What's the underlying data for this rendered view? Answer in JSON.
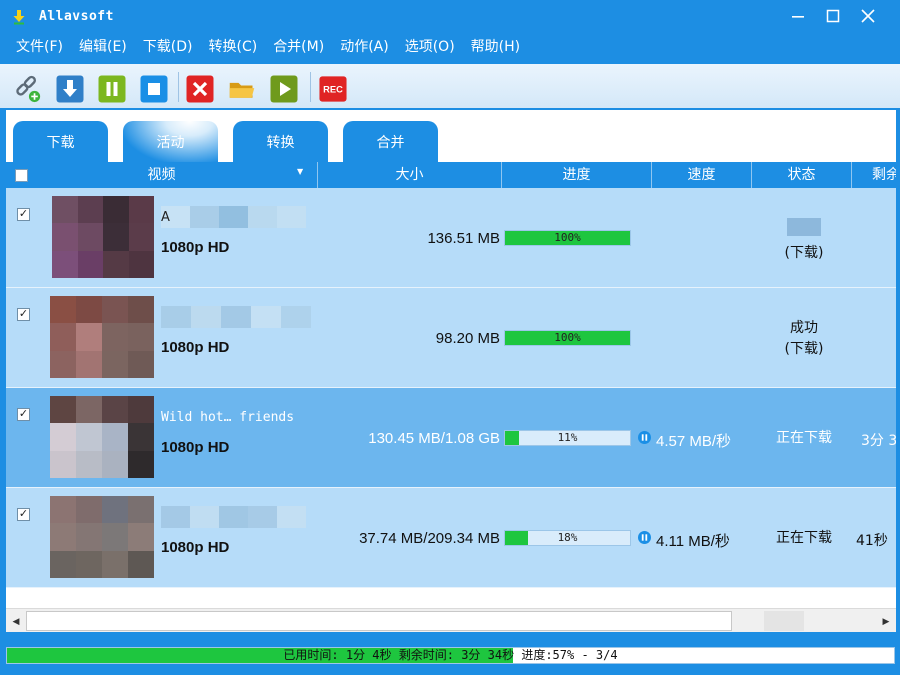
{
  "window": {
    "title": "Allavsoft",
    "icon": "download-arrow-icon",
    "controls": [
      "minimize-icon",
      "maximize-icon",
      "close-icon"
    ]
  },
  "menu": [
    "文件(F)",
    "编辑(E)",
    "下载(D)",
    "转换(C)",
    "合并(M)",
    "动作(A)",
    "选项(O)",
    "帮助(H)"
  ],
  "toolbar": {
    "buttons": [
      {
        "name": "paste-url",
        "icon": "link-add-icon"
      },
      {
        "name": "download",
        "icon": "download-icon"
      },
      {
        "name": "pause",
        "icon": "pause-icon"
      },
      {
        "name": "stop",
        "icon": "stop-icon"
      },
      {
        "name": "delete",
        "icon": "delete-icon"
      },
      {
        "name": "open-folder",
        "icon": "folder-icon"
      },
      {
        "name": "play",
        "icon": "play-icon"
      },
      {
        "name": "record",
        "icon": "rec-icon",
        "label": "REC"
      }
    ]
  },
  "tabs": [
    {
      "label": "下载",
      "active": false
    },
    {
      "label": "活动",
      "active": true
    },
    {
      "label": "转换",
      "active": false
    },
    {
      "label": "合并",
      "active": false
    }
  ],
  "table": {
    "headers": {
      "video": "视频",
      "size": "大小",
      "progress": "进度",
      "speed": "速度",
      "status": "状态",
      "remaining": "剩余"
    },
    "rows": [
      {
        "checked": true,
        "selected": false,
        "title": "A",
        "quality": "1080p HD",
        "size": "136.51 MB",
        "progress": 100,
        "progress_text": "100%",
        "speed": "",
        "status_line1": "",
        "status_line2": "(下载)",
        "remaining": ""
      },
      {
        "checked": true,
        "selected": false,
        "title": "",
        "quality": "1080p HD",
        "size": "98.20 MB",
        "progress": 100,
        "progress_text": "100%",
        "speed": "",
        "status_line1": "成功",
        "status_line2": "(下载)",
        "remaining": ""
      },
      {
        "checked": true,
        "selected": true,
        "title": "Wild hot… friends",
        "quality": "1080p HD",
        "size": "130.45 MB/1.08 GB",
        "progress": 11,
        "progress_text": "11%",
        "speed": "4.57 MB/秒",
        "status_line1": "正在下载",
        "status_line2": "",
        "remaining": "3分 3"
      },
      {
        "checked": true,
        "selected": false,
        "title": "",
        "quality": "1080p HD",
        "size": "37.74 MB/209.34 MB",
        "progress": 18,
        "progress_text": "18%",
        "speed": "4.11 MB/秒",
        "status_line1": "正在下载",
        "status_line2": "",
        "remaining": "41秒"
      }
    ]
  },
  "statusbar": {
    "text": "已用时间: 1分 4秒 剩余时间: 3分 34秒 进度:57% - 3/4",
    "progress": 57
  },
  "colors": {
    "accent": "#1d8ee3",
    "progress_green": "#1ec63f",
    "row_bg": "#b6dcf9",
    "row_selected": "#6cb6ee"
  }
}
